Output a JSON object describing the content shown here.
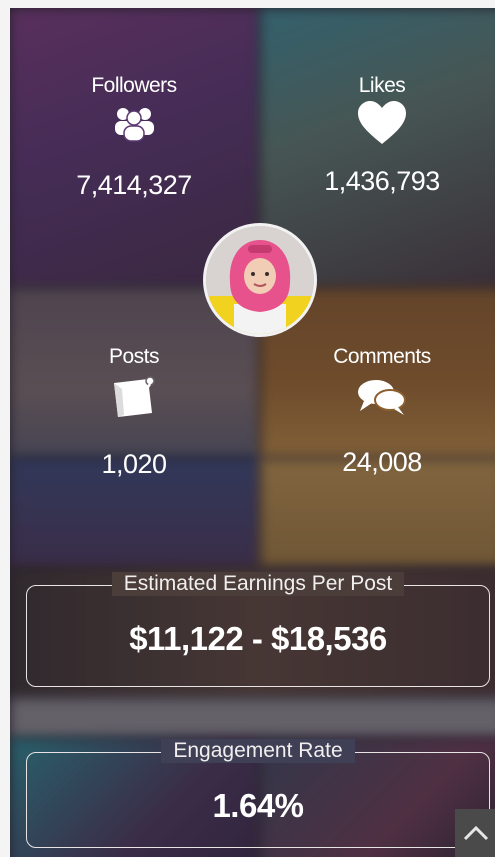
{
  "stats": {
    "followers": {
      "label": "Followers",
      "value": "7,414,327",
      "icon": "people-group-icon"
    },
    "likes": {
      "label": "Likes",
      "value": "1,436,793",
      "icon": "heart-icon"
    },
    "posts": {
      "label": "Posts",
      "value": "1,020",
      "icon": "post-note-icon"
    },
    "comments": {
      "label": "Comments",
      "value": "24,008",
      "icon": "chat-bubbles-icon"
    }
  },
  "earnings": {
    "title": "Estimated Earnings Per Post",
    "value": "$11,122 - $18,536"
  },
  "engagement": {
    "title": "Engagement Rate",
    "value": "1.64%"
  },
  "scroll_top": {
    "icon": "chevron-up-icon"
  }
}
